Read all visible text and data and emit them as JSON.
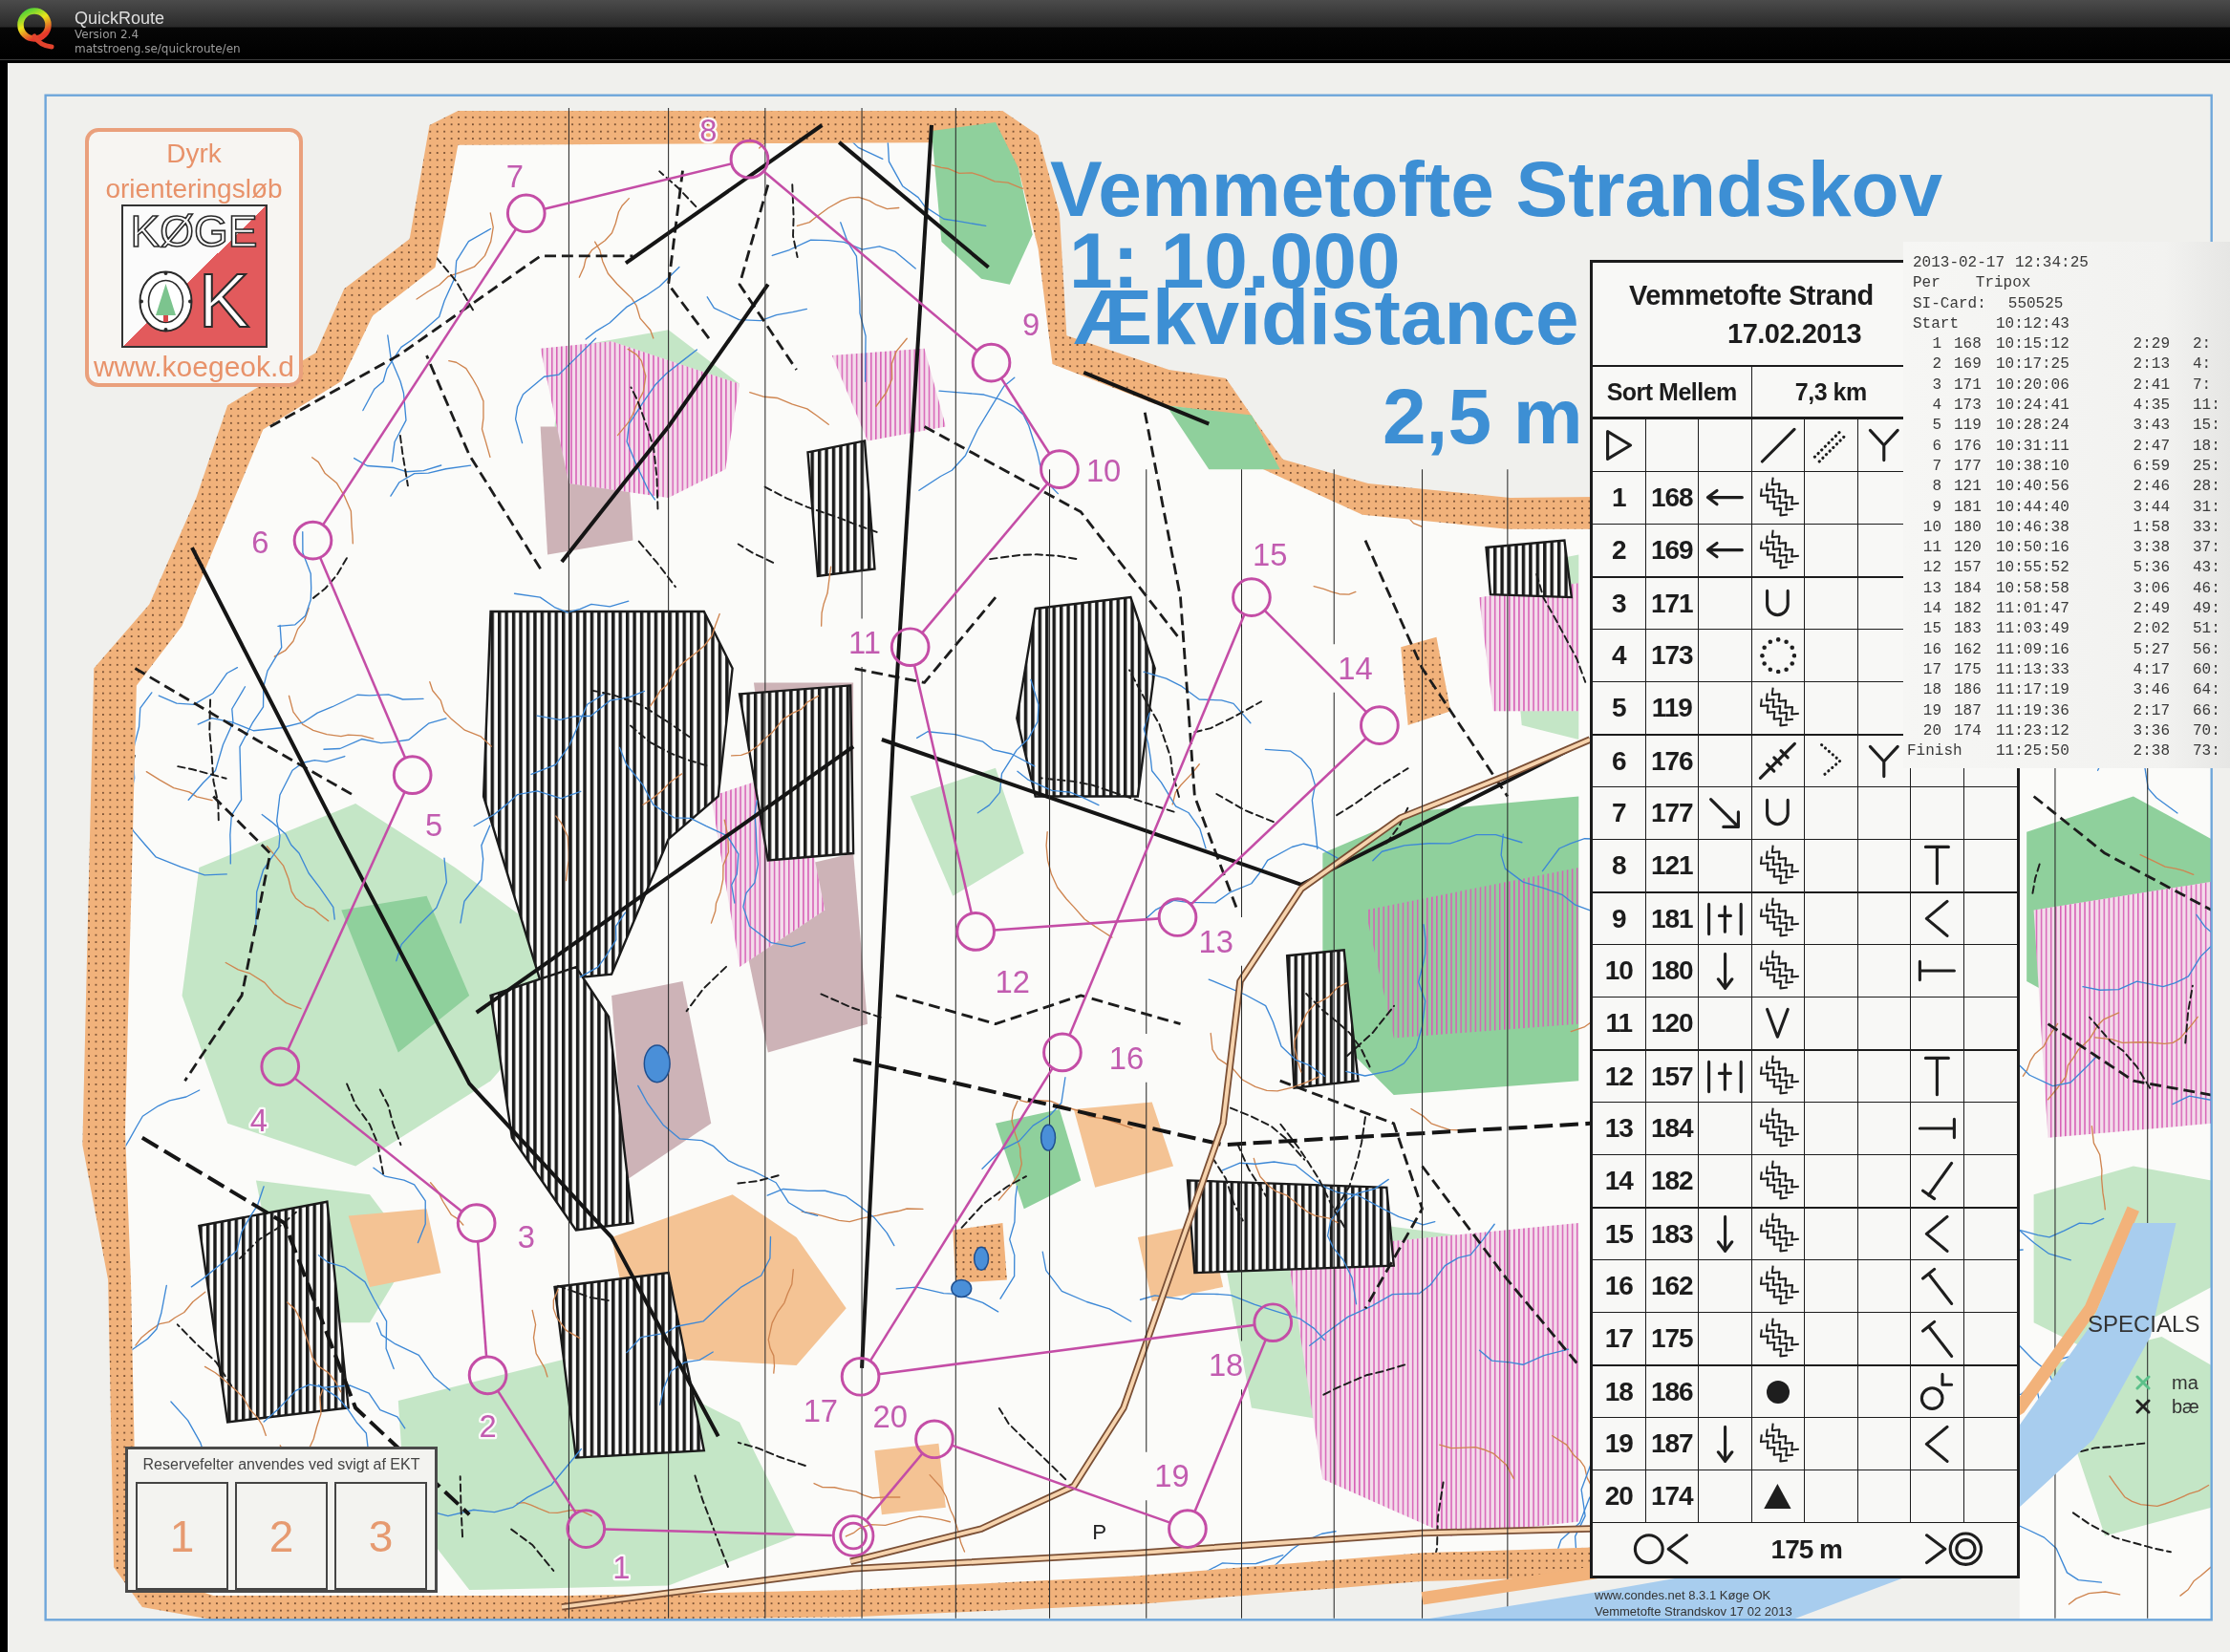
{
  "app_header": {
    "title": "QuickRoute",
    "version": "Version 2.4",
    "url": "matstroeng.se/quickroute/en"
  },
  "map": {
    "title": "Vemmetofte Strandskov",
    "scale": "1: 10.000",
    "contour_heading": "Ækvidistance",
    "contour_interval": "2,5 m",
    "club_logo": {
      "slogan_line_1": "Dyrk",
      "slogan_line_2": "orienteringsløb",
      "club_name": "KØGE",
      "club_letter": "K",
      "website": "www.koegeok.d"
    },
    "course_controls": [
      "1",
      "2",
      "3",
      "4",
      "5",
      "6",
      "7",
      "8",
      "9",
      "10",
      "11",
      "12",
      "13",
      "14",
      "15",
      "16",
      "17",
      "18",
      "19",
      "20"
    ],
    "place_label": "P",
    "reserve_box": {
      "title": "Reservefelter anvendes ved svigt af EKT",
      "fields": [
        "1",
        "2",
        "3"
      ]
    },
    "specials": {
      "title": "SPECIALS",
      "items": [
        {
          "label": "ma",
          "color": "#5cc08a"
        },
        {
          "label": "bæ",
          "color": "#222222"
        }
      ]
    },
    "footer": [
      "www.condes.net 8.3.1 Køge OK",
      "Vemmetofte Strandskov 17 02 2013"
    ]
  },
  "control_descriptions": {
    "event": "Vemmetofte Strand",
    "date": "17.02.2013",
    "course": "Sort Mellem",
    "length": "7,3 km",
    "start": {
      "column_a": {
        "kind": "start-triangle"
      },
      "column_d": {
        "kind": "slash"
      },
      "column_e": {
        "kind": "dotted-slash"
      },
      "column_f": {
        "kind": "fork"
      }
    },
    "controls": [
      {
        "number": "1",
        "code": "168",
        "column_c": {
          "kind": "left-arrow"
        },
        "column_d": {
          "kind": "zigzag"
        }
      },
      {
        "number": "2",
        "code": "169",
        "column_c": {
          "kind": "left-arrow"
        },
        "column_d": {
          "kind": "zigzag"
        }
      },
      {
        "number": "3",
        "code": "171",
        "column_d": {
          "kind": "u-shape"
        }
      },
      {
        "number": "4",
        "code": "173",
        "column_d": {
          "kind": "dotted-circle"
        }
      },
      {
        "number": "5",
        "code": "119",
        "column_d": {
          "kind": "zigzag"
        }
      },
      {
        "number": "6",
        "code": "176",
        "column_d": {
          "kind": "ticked-line"
        },
        "column_e": {
          "kind": "dotted-chevron"
        },
        "column_f": {
          "kind": "fork"
        }
      },
      {
        "number": "7",
        "code": "177",
        "column_c": {
          "kind": "down-right-arrow"
        },
        "column_d": {
          "kind": "u-shape"
        }
      },
      {
        "number": "8",
        "code": "121",
        "column_d": {
          "kind": "zigzag"
        },
        "column_g": {
          "kind": "t-top"
        }
      },
      {
        "number": "9",
        "code": "181",
        "column_c": {
          "kind": "between"
        },
        "column_d": {
          "kind": "zigzag"
        },
        "column_g": {
          "kind": "angle"
        }
      },
      {
        "number": "10",
        "code": "180",
        "column_c": {
          "kind": "down-arrow"
        },
        "column_d": {
          "kind": "zigzag"
        },
        "column_g": {
          "kind": "bar-left"
        }
      },
      {
        "number": "11",
        "code": "120",
        "column_d": {
          "kind": "v-shape"
        }
      },
      {
        "number": "12",
        "code": "157",
        "column_c": {
          "kind": "between"
        },
        "column_d": {
          "kind": "zigzag"
        },
        "column_g": {
          "kind": "t-top"
        }
      },
      {
        "number": "13",
        "code": "184",
        "column_d": {
          "kind": "zigzag"
        },
        "column_g": {
          "kind": "bar-right"
        }
      },
      {
        "number": "14",
        "code": "182",
        "column_d": {
          "kind": "zigzag"
        },
        "column_g": {
          "kind": "tick"
        }
      },
      {
        "number": "15",
        "code": "183",
        "column_c": {
          "kind": "down-arrow"
        },
        "column_d": {
          "kind": "zigzag"
        },
        "column_g": {
          "kind": "angle"
        }
      },
      {
        "number": "16",
        "code": "162",
        "column_d": {
          "kind": "zigzag"
        },
        "column_g": {
          "kind": "slant-bar"
        }
      },
      {
        "number": "17",
        "code": "175",
        "column_d": {
          "kind": "zigzag"
        },
        "column_g": {
          "kind": "slant-bar"
        }
      },
      {
        "number": "18",
        "code": "186",
        "column_d": {
          "kind": "filled-circle"
        },
        "column_g": {
          "kind": "circle-l"
        }
      },
      {
        "number": "19",
        "code": "187",
        "column_c": {
          "kind": "down-arrow"
        },
        "column_d": {
          "kind": "zigzag"
        },
        "column_g": {
          "kind": "angle"
        }
      },
      {
        "number": "20",
        "code": "174",
        "column_d": {
          "kind": "filled-triangle"
        }
      }
    ],
    "finish_distance": "175 m"
  },
  "si_printout": {
    "date": "2013-02-17",
    "time": "12:34:25",
    "first_name": "Per",
    "last_name": "Tripox",
    "card_label": "SI-Card:",
    "card_number": "550525",
    "start_label": "Start",
    "start_time": "10:12:43",
    "punches": [
      {
        "number": "1",
        "code": "168",
        "time": "10:15:12",
        "split": "2:29",
        "total": "2:"
      },
      {
        "number": "2",
        "code": "169",
        "time": "10:17:25",
        "split": "2:13",
        "total": "4:"
      },
      {
        "number": "3",
        "code": "171",
        "time": "10:20:06",
        "split": "2:41",
        "total": "7:"
      },
      {
        "number": "4",
        "code": "173",
        "time": "10:24:41",
        "split": "4:35",
        "total": "11:"
      },
      {
        "number": "5",
        "code": "119",
        "time": "10:28:24",
        "split": "3:43",
        "total": "15:"
      },
      {
        "number": "6",
        "code": "176",
        "time": "10:31:11",
        "split": "2:47",
        "total": "18:"
      },
      {
        "number": "7",
        "code": "177",
        "time": "10:38:10",
        "split": "6:59",
        "total": "25:"
      },
      {
        "number": "8",
        "code": "121",
        "time": "10:40:56",
        "split": "2:46",
        "total": "28:"
      },
      {
        "number": "9",
        "code": "181",
        "time": "10:44:40",
        "split": "3:44",
        "total": "31:"
      },
      {
        "number": "10",
        "code": "180",
        "time": "10:46:38",
        "split": "1:58",
        "total": "33:"
      },
      {
        "number": "11",
        "code": "120",
        "time": "10:50:16",
        "split": "3:38",
        "total": "37:"
      },
      {
        "number": "12",
        "code": "157",
        "time": "10:55:52",
        "split": "5:36",
        "total": "43:"
      },
      {
        "number": "13",
        "code": "184",
        "time": "10:58:58",
        "split": "3:06",
        "total": "46:"
      },
      {
        "number": "14",
        "code": "182",
        "time": "11:01:47",
        "split": "2:49",
        "total": "49:"
      },
      {
        "number": "15",
        "code": "183",
        "time": "11:03:49",
        "split": "2:02",
        "total": "51:"
      },
      {
        "number": "16",
        "code": "162",
        "time": "11:09:16",
        "split": "5:27",
        "total": "56:"
      },
      {
        "number": "17",
        "code": "175",
        "time": "11:13:33",
        "split": "4:17",
        "total": "60:"
      },
      {
        "number": "18",
        "code": "186",
        "time": "11:17:19",
        "split": "3:46",
        "total": "64:"
      },
      {
        "number": "19",
        "code": "187",
        "time": "11:19:36",
        "split": "2:17",
        "total": "66:"
      },
      {
        "number": "20",
        "code": "174",
        "time": "11:23:12",
        "split": "3:36",
        "total": "70:"
      }
    ],
    "finish": {
      "label": "Finish",
      "time": "11:25:50",
      "split": "2:38",
      "total": "73:"
    }
  }
}
